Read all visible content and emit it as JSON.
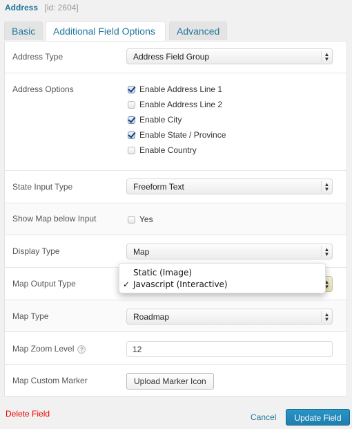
{
  "header": {
    "field_name": "Address",
    "field_id": "[id: 2604]"
  },
  "tabs": [
    {
      "label": "Basic",
      "active": false
    },
    {
      "label": "Additional Field Options",
      "active": true
    },
    {
      "label": "Advanced",
      "active": false
    }
  ],
  "fields": {
    "address_type": {
      "label": "Address Type",
      "value": "Address Field Group"
    },
    "address_options": {
      "label": "Address Options",
      "options": [
        {
          "label": "Enable Address Line 1",
          "checked": true
        },
        {
          "label": "Enable Address Line 2",
          "checked": false
        },
        {
          "label": "Enable City",
          "checked": true
        },
        {
          "label": "Enable State / Province",
          "checked": true
        },
        {
          "label": "Enable Country",
          "checked": false
        }
      ]
    },
    "state_input_type": {
      "label": "State Input Type",
      "value": "Freeform Text"
    },
    "show_map": {
      "label": "Show Map below Input",
      "option_label": "Yes",
      "checked": false
    },
    "display_type": {
      "label": "Display Type",
      "value": "Map"
    },
    "map_output_type": {
      "label": "Map Output Type",
      "options": [
        "Static (Image)",
        "Javascript (Interactive)"
      ],
      "selected": "Javascript (Interactive)",
      "check_glyph": "✓"
    },
    "map_type": {
      "label": "Map Type",
      "value": "Roadmap"
    },
    "map_zoom_level": {
      "label": "Map Zoom Level",
      "value": "12",
      "help_glyph": "?"
    },
    "map_custom_marker": {
      "label": "Map Custom Marker",
      "button_label": "Upload Marker Icon"
    }
  },
  "footer": {
    "delete_label": "Delete Field",
    "cancel_label": "Cancel",
    "update_label": "Update Field"
  },
  "colors": {
    "link": "#21759b",
    "danger": "#ee0000",
    "primary_button": "#2283b8"
  },
  "icons": {
    "select_arrow": "▲▼"
  }
}
